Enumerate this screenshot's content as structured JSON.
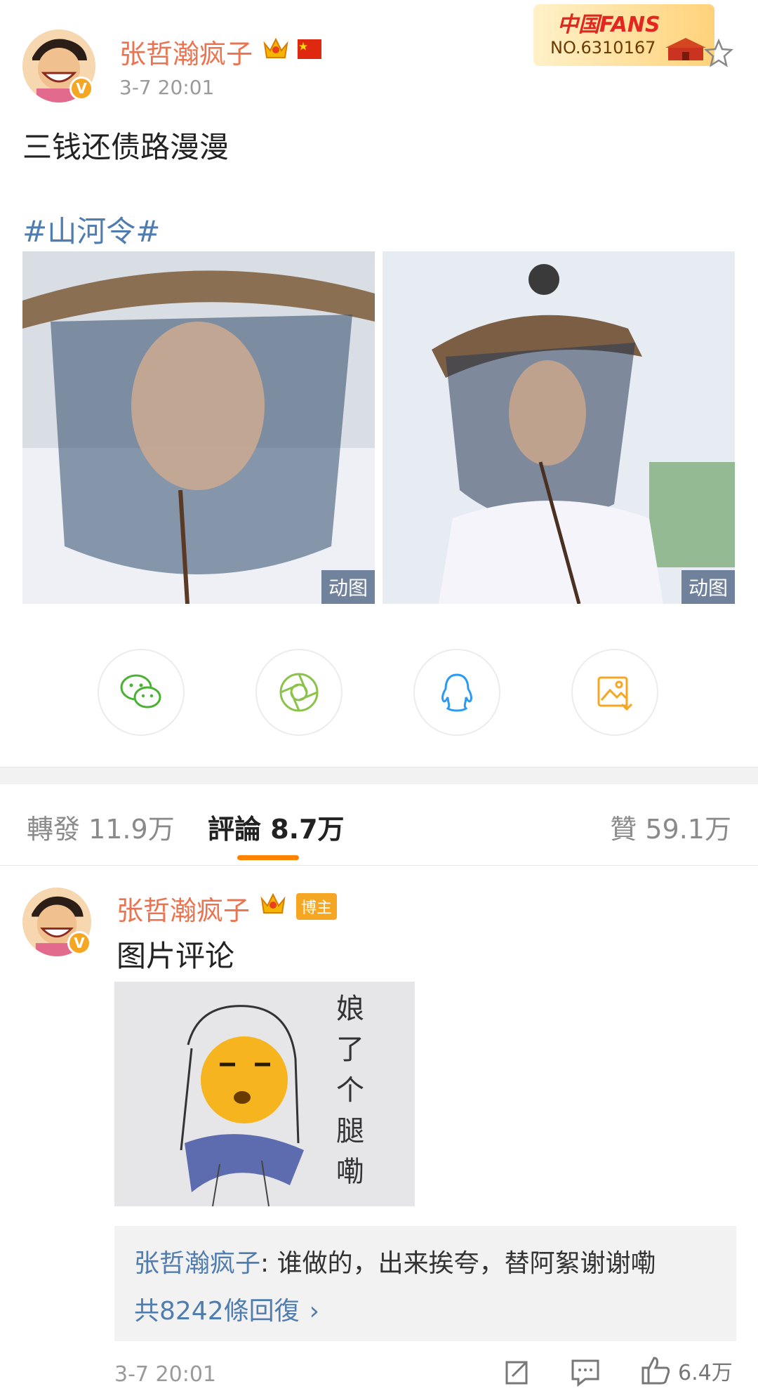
{
  "post": {
    "author": "张哲瀚疯子",
    "time": "3-7 20:01",
    "fans_badge_top": "中国FANS",
    "fans_badge_no": "NO.6310167",
    "text": "三钱还债路漫漫",
    "hashtag": "#山河令#",
    "media_badge": "动图",
    "media_badge_2": "动图"
  },
  "share": {
    "items": [
      {
        "icon": "wechat-icon"
      },
      {
        "icon": "moments-icon"
      },
      {
        "icon": "qq-icon"
      },
      {
        "icon": "save-image-icon"
      }
    ]
  },
  "tabs": {
    "repost": "轉發 11.9万",
    "comment": "評論 8.7万",
    "like": "贊 59.1万"
  },
  "comment": {
    "author": "张哲瀚疯子",
    "role_badge": "博主",
    "text": "图片评论",
    "sticker_text": "娘了个腿嘞",
    "reply_author": "张哲瀚疯子",
    "reply_text": ": 谁做的，出来挨夸，替阿絮谢谢嘞",
    "reply_more": "共8242條回復",
    "time": "3-7 20:01",
    "likes": "6.4万"
  },
  "colors": {
    "username": "#eb7350",
    "link": "#507daf",
    "accent": "#ff8200"
  }
}
